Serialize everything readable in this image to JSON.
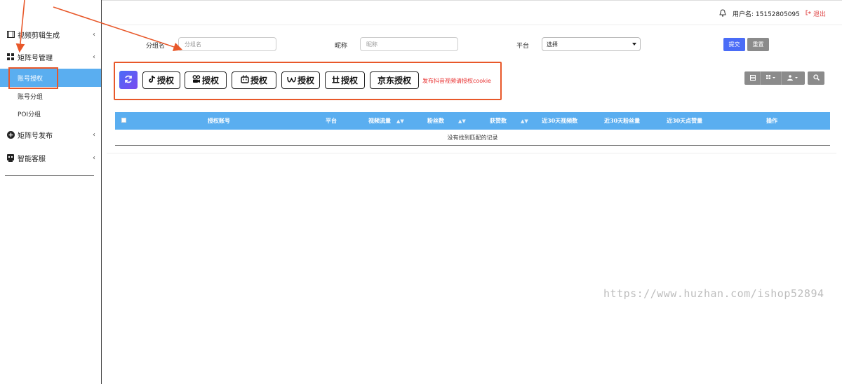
{
  "sidebar": {
    "items": [
      {
        "label": "视频剪辑生成",
        "icon": "film-icon"
      },
      {
        "label": "矩阵号管理",
        "icon": "grid-icon"
      },
      {
        "label": "矩阵号发布",
        "icon": "plus-circle-icon"
      },
      {
        "label": "智能客服",
        "icon": "robot-icon"
      }
    ],
    "sub_items": [
      {
        "label": "账号授权",
        "active": true
      },
      {
        "label": "账号分组"
      },
      {
        "label": "POI分组"
      }
    ]
  },
  "topbar": {
    "user_label": "用户名: 15152805095",
    "logout_label": "退出"
  },
  "filters": {
    "group_label": "分组名",
    "group_placeholder": "分组名",
    "nickname_label": "昵称",
    "nickname_placeholder": "昵称",
    "platform_label": "平台",
    "platform_value": "选择",
    "submit_label": "提交",
    "reset_label": "重置"
  },
  "auth": {
    "buttons": [
      {
        "label": "授权",
        "icon": "douyin-icon"
      },
      {
        "label": "授权",
        "icon": "kuaishou-icon"
      },
      {
        "label": "授权",
        "icon": "bilibili-icon"
      },
      {
        "label": "授权",
        "icon": "weixin-channels-icon"
      },
      {
        "label": "授权",
        "icon": "xiaohongshu-icon"
      },
      {
        "label": "京东授权",
        "icon": ""
      }
    ],
    "note": "发布抖音视频请授权cookie"
  },
  "table": {
    "columns": [
      "授权账号",
      "平台",
      "视频流量",
      "粉丝数",
      "获赞数",
      "近30天视频数",
      "近30天粉丝量",
      "近30天点赞量",
      "操作"
    ],
    "empty_text": "没有找到匹配的记录"
  },
  "watermark": "https://www.huzhan.com/ishop52894",
  "colors": {
    "accent": "#5aaef0",
    "annotation": "#e8582a",
    "primary_button": "#4a6cf7",
    "secondary_button": "#8b8b8b",
    "danger_text": "#e83030"
  }
}
